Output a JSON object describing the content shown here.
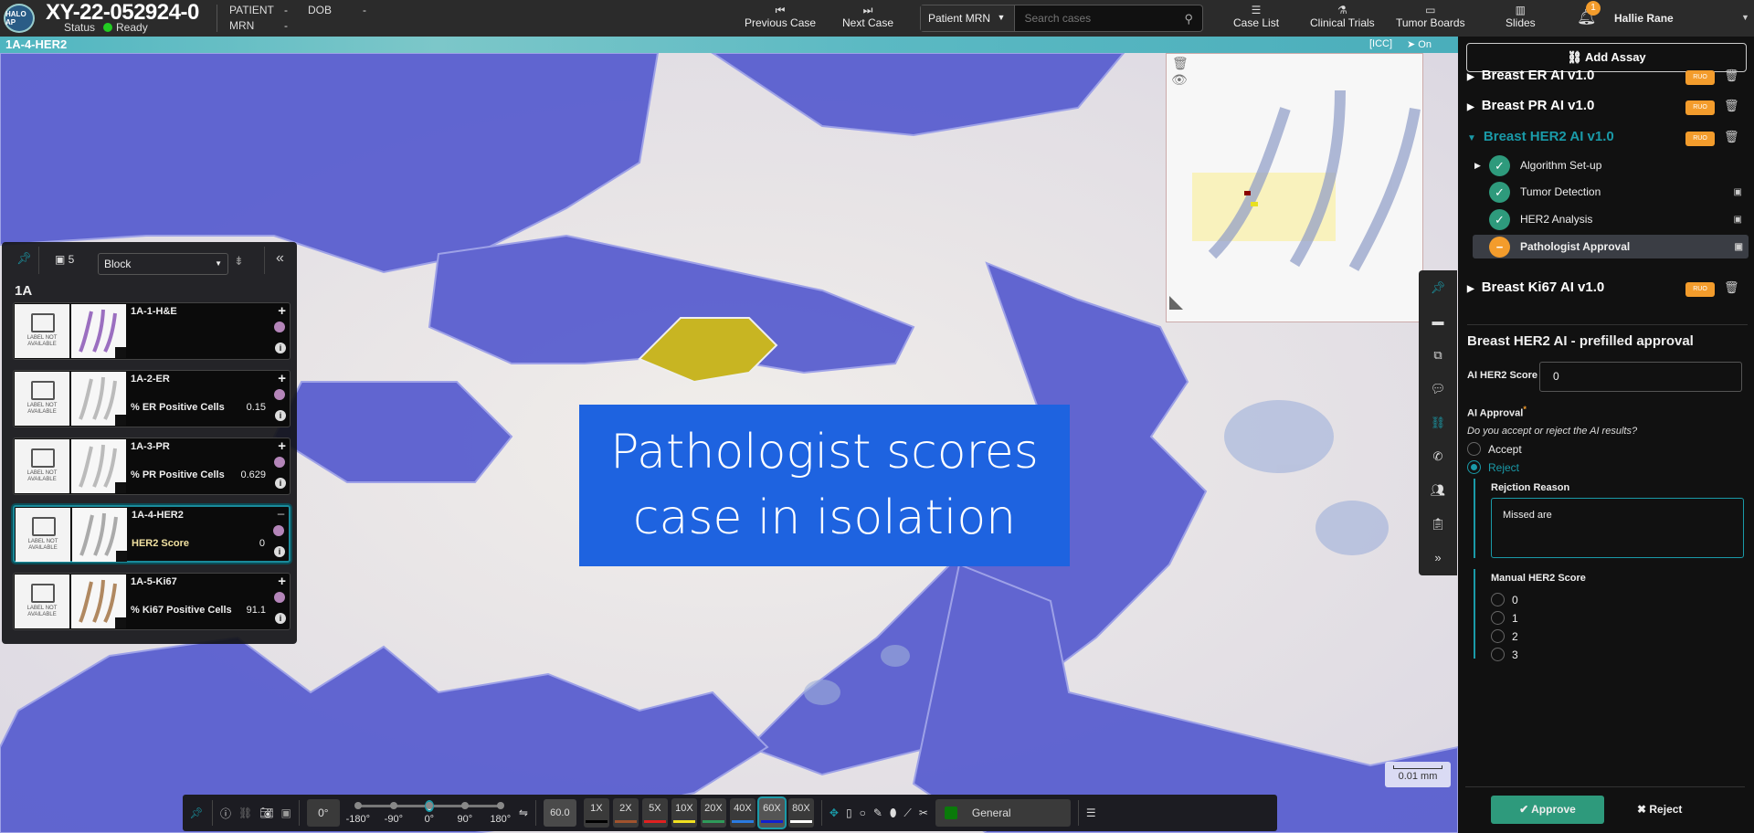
{
  "header": {
    "logo_text": "HALO AP",
    "case_id": "XY-22-052924-0",
    "status_label": "Status",
    "status_value": "Ready",
    "patient_label": "PATIENT",
    "patient_value": "-",
    "dob_label": "DOB",
    "dob_value": "-",
    "mrn_label": "MRN",
    "mrn_value": "-",
    "prev_case": "Previous Case",
    "next_case": "Next Case",
    "search_field": "Patient MRN",
    "search_placeholder": "Search cases",
    "nav": [
      "Case List",
      "Clinical Trials",
      "Tumor Boards",
      "Slides"
    ],
    "notifications": "1",
    "user": "Hallie Rane"
  },
  "viewer": {
    "slide_title": "1A-4-HER2",
    "icc": "[ICC]",
    "on": "On",
    "overlay_text": [
      "Pathologist scores",
      "case in isolation"
    ],
    "scale_bar": "0.01 mm"
  },
  "slide_panel": {
    "count": "5",
    "group_by": "Block",
    "block": "1A",
    "label_na": "LABEL NOT AVAILABLE",
    "slides": [
      {
        "name": "1A-1-H&E",
        "metric": "",
        "value": ""
      },
      {
        "name": "1A-2-ER",
        "metric": "% ER Positive Cells",
        "value": "0.15"
      },
      {
        "name": "1A-3-PR",
        "metric": "% PR Positive Cells",
        "value": "0.629"
      },
      {
        "name": "1A-4-HER2",
        "metric": "HER2 Score",
        "value": "0"
      },
      {
        "name": "1A-5-Ki67",
        "metric": "% Ki67 Positive Cells",
        "value": "91.1"
      }
    ]
  },
  "toolbar": {
    "rotation": "0°",
    "rot_ticks": [
      "-180°",
      "-90°",
      "0°",
      "90°",
      "180°"
    ],
    "rotation_fraction": 0.5,
    "zoom_value": "60.0",
    "zooms": [
      {
        "l": "1X",
        "c": "#000000"
      },
      {
        "l": "2X",
        "c": "#a0522d"
      },
      {
        "l": "5X",
        "c": "#e02020"
      },
      {
        "l": "10X",
        "c": "#f0e020"
      },
      {
        "l": "20X",
        "c": "#2e9a5a"
      },
      {
        "l": "40X",
        "c": "#2a7ae0"
      },
      {
        "l": "60X",
        "c": "#1020d0"
      },
      {
        "l": "80X",
        "c": "#ffffff"
      }
    ],
    "active_zoom": "60X",
    "annotation_layer": "General"
  },
  "right_panel": {
    "add_assay": "Add Assay",
    "ruo": "RUO",
    "assays": [
      {
        "name": "Breast ER AI v1.0"
      },
      {
        "name": "Breast PR AI v1.0"
      },
      {
        "name": "Breast HER2 AI v1.0"
      },
      {
        "name": "Breast Ki67 AI v1.0"
      }
    ],
    "steps": [
      "Algorithm Set-up",
      "Tumor Detection",
      "HER2 Analysis",
      "Pathologist Approval"
    ],
    "form": {
      "title": "Breast HER2 AI - prefilled approval",
      "ai_score_label": "AI HER2 Score",
      "ai_score_value": "0",
      "approval_label": "AI Approval",
      "required": "*",
      "question": "Do you accept or reject the AI results?",
      "accept": "Accept",
      "reject": "Reject",
      "reason_label": "Rejction Reason",
      "reason_value": "Missed are",
      "manual_label": "Manual HER2 Score",
      "manual_options": [
        "0",
        "1",
        "2",
        "3"
      ]
    },
    "approve": "Approve",
    "reject_btn": "Reject"
  },
  "colors": {
    "accent": "#1a9aa8",
    "ruo": "#f39c2c",
    "approve": "#2e9a7c",
    "overlay": "#1e63e0"
  }
}
